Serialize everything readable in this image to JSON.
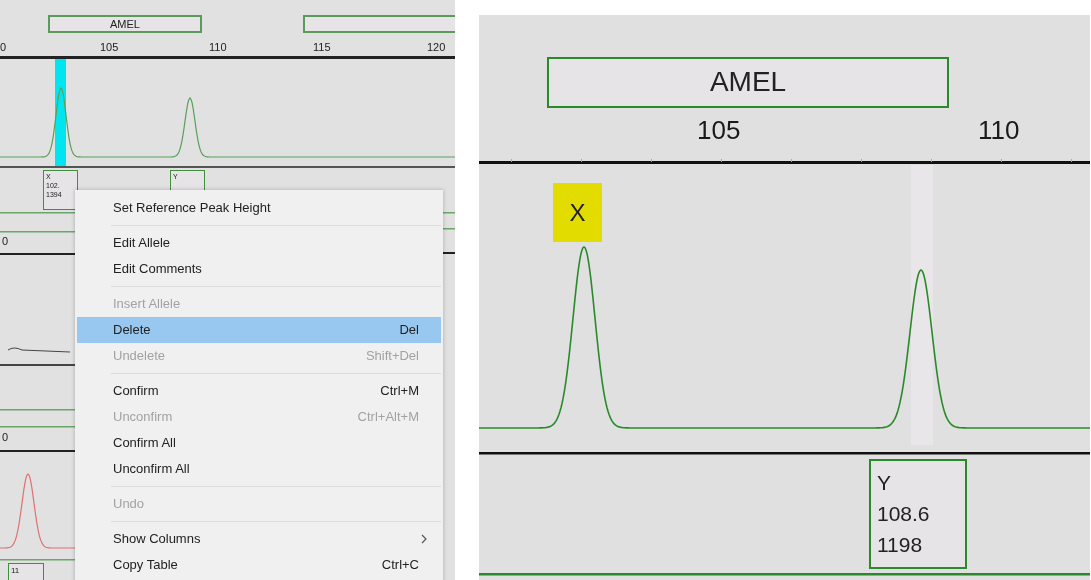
{
  "left_view": {
    "marker": "AMEL",
    "axis_ticks": [
      "0",
      "105",
      "110",
      "115",
      "120"
    ],
    "selected_peak": true,
    "allele_labels": [
      {
        "lines": [
          "X",
          "102.",
          "1394"
        ]
      },
      {
        "lines": [
          "Y"
        ]
      }
    ],
    "panel_labels": [
      "0",
      "0"
    ],
    "bottom_allele_label": "11"
  },
  "context_menu": [
    {
      "kind": "item",
      "label": "Set Reference Peak Height",
      "disabled": false,
      "selected": false
    },
    {
      "kind": "separator"
    },
    {
      "kind": "item",
      "label": "Edit Allele",
      "disabled": false,
      "selected": false
    },
    {
      "kind": "item",
      "label": "Edit Comments",
      "disabled": false,
      "selected": false
    },
    {
      "kind": "separator"
    },
    {
      "kind": "item",
      "label": "Insert Allele",
      "disabled": true,
      "selected": false
    },
    {
      "kind": "item",
      "label": "Delete",
      "shortcut": "Del",
      "disabled": false,
      "selected": true
    },
    {
      "kind": "item",
      "label": "Undelete",
      "shortcut": "Shift+Del",
      "disabled": true,
      "selected": false
    },
    {
      "kind": "separator"
    },
    {
      "kind": "item",
      "label": "Confirm",
      "shortcut": "Ctrl+M",
      "disabled": false,
      "selected": false
    },
    {
      "kind": "item",
      "label": "Unconfirm",
      "shortcut": "Ctrl+Alt+M",
      "disabled": true,
      "selected": false
    },
    {
      "kind": "item",
      "label": "Confirm All",
      "disabled": false,
      "selected": false
    },
    {
      "kind": "item",
      "label": "Unconfirm All",
      "disabled": false,
      "selected": false
    },
    {
      "kind": "separator"
    },
    {
      "kind": "item",
      "label": "Undo",
      "disabled": true,
      "selected": false
    },
    {
      "kind": "separator"
    },
    {
      "kind": "submenu",
      "label": "Show Columns",
      "disabled": false,
      "selected": false
    },
    {
      "kind": "item",
      "label": "Copy Table",
      "shortcut": "Ctrl+C",
      "disabled": false,
      "selected": false
    }
  ],
  "right_view": {
    "marker": "AMEL",
    "axis_ticks": [
      "105",
      "110"
    ],
    "allele_call": "X",
    "allele_label": {
      "lines": [
        "Y",
        "108.6",
        "1198"
      ]
    }
  }
}
